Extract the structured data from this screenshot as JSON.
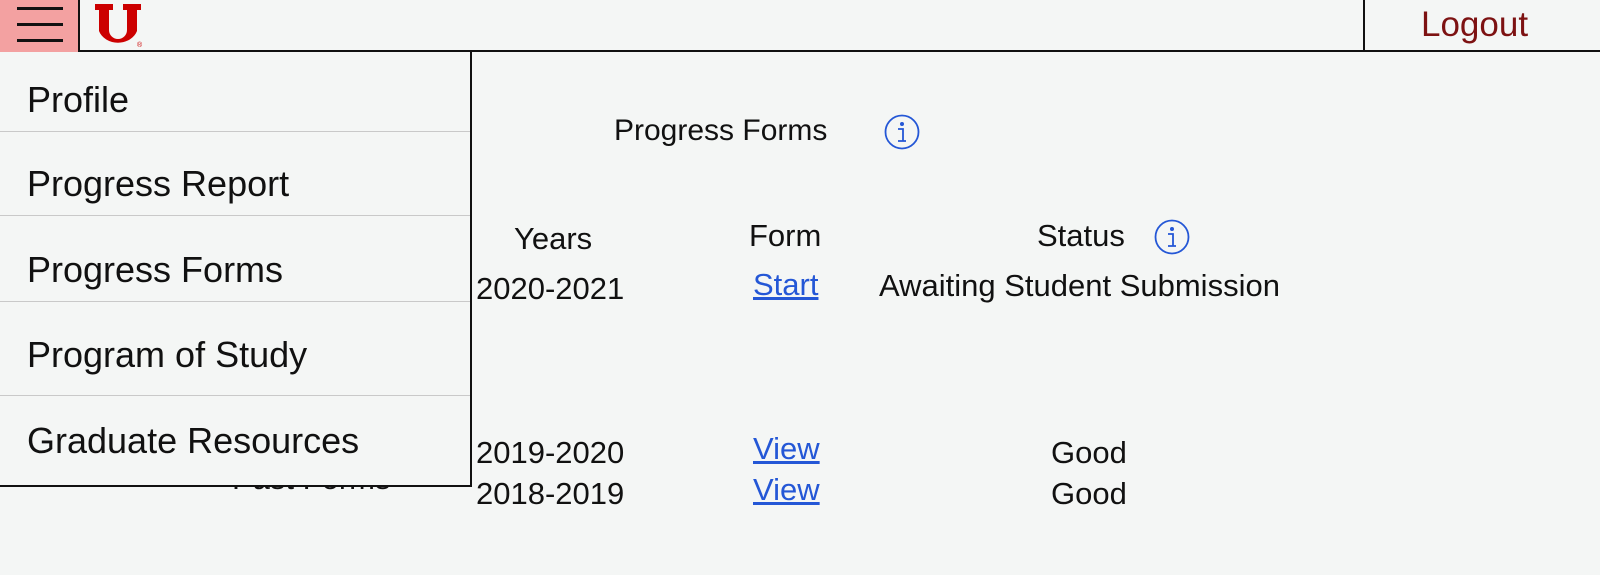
{
  "header": {
    "logo_letter": "U",
    "logout_label": "Logout"
  },
  "colors": {
    "hamburger_bg": "#f3a1a1",
    "brand_red": "#cc0000",
    "logout_text": "#7d1212",
    "link_blue": "#2457d6"
  },
  "menu": {
    "items": [
      {
        "label": "Profile"
      },
      {
        "label": "Progress Report"
      },
      {
        "label": "Progress Forms"
      },
      {
        "label": "Program of Study"
      },
      {
        "label": "Graduate Resources"
      }
    ]
  },
  "main": {
    "title": "Progress Forms",
    "columns": {
      "years": "Years",
      "form": "Form",
      "status": "Status"
    },
    "current_form": {
      "years": "2020-2021",
      "action": "Start",
      "status": "Awaiting Student Submission"
    },
    "past_forms_label": "Past Forms",
    "past_forms": [
      {
        "years": "2019-2020",
        "action": "View",
        "status": "Good"
      },
      {
        "years": "2018-2019",
        "action": "View",
        "status": "Good"
      }
    ]
  },
  "icons": {
    "menu": "hamburger-icon",
    "info": "info-icon"
  }
}
